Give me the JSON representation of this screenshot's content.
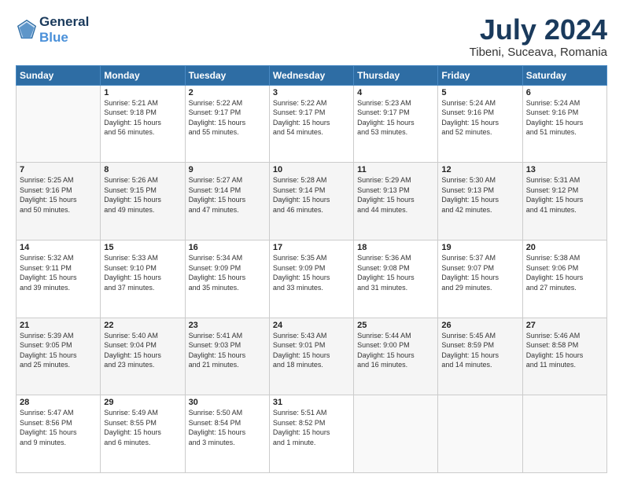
{
  "header": {
    "logo_line1": "General",
    "logo_line2": "Blue",
    "title": "July 2024",
    "subtitle": "Tibeni, Suceava, Romania"
  },
  "calendar": {
    "days_of_week": [
      "Sunday",
      "Monday",
      "Tuesday",
      "Wednesday",
      "Thursday",
      "Friday",
      "Saturday"
    ],
    "weeks": [
      [
        {
          "day": "",
          "info": ""
        },
        {
          "day": "1",
          "info": "Sunrise: 5:21 AM\nSunset: 9:18 PM\nDaylight: 15 hours\nand 56 minutes."
        },
        {
          "day": "2",
          "info": "Sunrise: 5:22 AM\nSunset: 9:17 PM\nDaylight: 15 hours\nand 55 minutes."
        },
        {
          "day": "3",
          "info": "Sunrise: 5:22 AM\nSunset: 9:17 PM\nDaylight: 15 hours\nand 54 minutes."
        },
        {
          "day": "4",
          "info": "Sunrise: 5:23 AM\nSunset: 9:17 PM\nDaylight: 15 hours\nand 53 minutes."
        },
        {
          "day": "5",
          "info": "Sunrise: 5:24 AM\nSunset: 9:16 PM\nDaylight: 15 hours\nand 52 minutes."
        },
        {
          "day": "6",
          "info": "Sunrise: 5:24 AM\nSunset: 9:16 PM\nDaylight: 15 hours\nand 51 minutes."
        }
      ],
      [
        {
          "day": "7",
          "info": "Sunrise: 5:25 AM\nSunset: 9:16 PM\nDaylight: 15 hours\nand 50 minutes."
        },
        {
          "day": "8",
          "info": "Sunrise: 5:26 AM\nSunset: 9:15 PM\nDaylight: 15 hours\nand 49 minutes."
        },
        {
          "day": "9",
          "info": "Sunrise: 5:27 AM\nSunset: 9:14 PM\nDaylight: 15 hours\nand 47 minutes."
        },
        {
          "day": "10",
          "info": "Sunrise: 5:28 AM\nSunset: 9:14 PM\nDaylight: 15 hours\nand 46 minutes."
        },
        {
          "day": "11",
          "info": "Sunrise: 5:29 AM\nSunset: 9:13 PM\nDaylight: 15 hours\nand 44 minutes."
        },
        {
          "day": "12",
          "info": "Sunrise: 5:30 AM\nSunset: 9:13 PM\nDaylight: 15 hours\nand 42 minutes."
        },
        {
          "day": "13",
          "info": "Sunrise: 5:31 AM\nSunset: 9:12 PM\nDaylight: 15 hours\nand 41 minutes."
        }
      ],
      [
        {
          "day": "14",
          "info": "Sunrise: 5:32 AM\nSunset: 9:11 PM\nDaylight: 15 hours\nand 39 minutes."
        },
        {
          "day": "15",
          "info": "Sunrise: 5:33 AM\nSunset: 9:10 PM\nDaylight: 15 hours\nand 37 minutes."
        },
        {
          "day": "16",
          "info": "Sunrise: 5:34 AM\nSunset: 9:09 PM\nDaylight: 15 hours\nand 35 minutes."
        },
        {
          "day": "17",
          "info": "Sunrise: 5:35 AM\nSunset: 9:09 PM\nDaylight: 15 hours\nand 33 minutes."
        },
        {
          "day": "18",
          "info": "Sunrise: 5:36 AM\nSunset: 9:08 PM\nDaylight: 15 hours\nand 31 minutes."
        },
        {
          "day": "19",
          "info": "Sunrise: 5:37 AM\nSunset: 9:07 PM\nDaylight: 15 hours\nand 29 minutes."
        },
        {
          "day": "20",
          "info": "Sunrise: 5:38 AM\nSunset: 9:06 PM\nDaylight: 15 hours\nand 27 minutes."
        }
      ],
      [
        {
          "day": "21",
          "info": "Sunrise: 5:39 AM\nSunset: 9:05 PM\nDaylight: 15 hours\nand 25 minutes."
        },
        {
          "day": "22",
          "info": "Sunrise: 5:40 AM\nSunset: 9:04 PM\nDaylight: 15 hours\nand 23 minutes."
        },
        {
          "day": "23",
          "info": "Sunrise: 5:41 AM\nSunset: 9:03 PM\nDaylight: 15 hours\nand 21 minutes."
        },
        {
          "day": "24",
          "info": "Sunrise: 5:43 AM\nSunset: 9:01 PM\nDaylight: 15 hours\nand 18 minutes."
        },
        {
          "day": "25",
          "info": "Sunrise: 5:44 AM\nSunset: 9:00 PM\nDaylight: 15 hours\nand 16 minutes."
        },
        {
          "day": "26",
          "info": "Sunrise: 5:45 AM\nSunset: 8:59 PM\nDaylight: 15 hours\nand 14 minutes."
        },
        {
          "day": "27",
          "info": "Sunrise: 5:46 AM\nSunset: 8:58 PM\nDaylight: 15 hours\nand 11 minutes."
        }
      ],
      [
        {
          "day": "28",
          "info": "Sunrise: 5:47 AM\nSunset: 8:56 PM\nDaylight: 15 hours\nand 9 minutes."
        },
        {
          "day": "29",
          "info": "Sunrise: 5:49 AM\nSunset: 8:55 PM\nDaylight: 15 hours\nand 6 minutes."
        },
        {
          "day": "30",
          "info": "Sunrise: 5:50 AM\nSunset: 8:54 PM\nDaylight: 15 hours\nand 3 minutes."
        },
        {
          "day": "31",
          "info": "Sunrise: 5:51 AM\nSunset: 8:52 PM\nDaylight: 15 hours\nand 1 minute."
        },
        {
          "day": "",
          "info": ""
        },
        {
          "day": "",
          "info": ""
        },
        {
          "day": "",
          "info": ""
        }
      ]
    ]
  }
}
